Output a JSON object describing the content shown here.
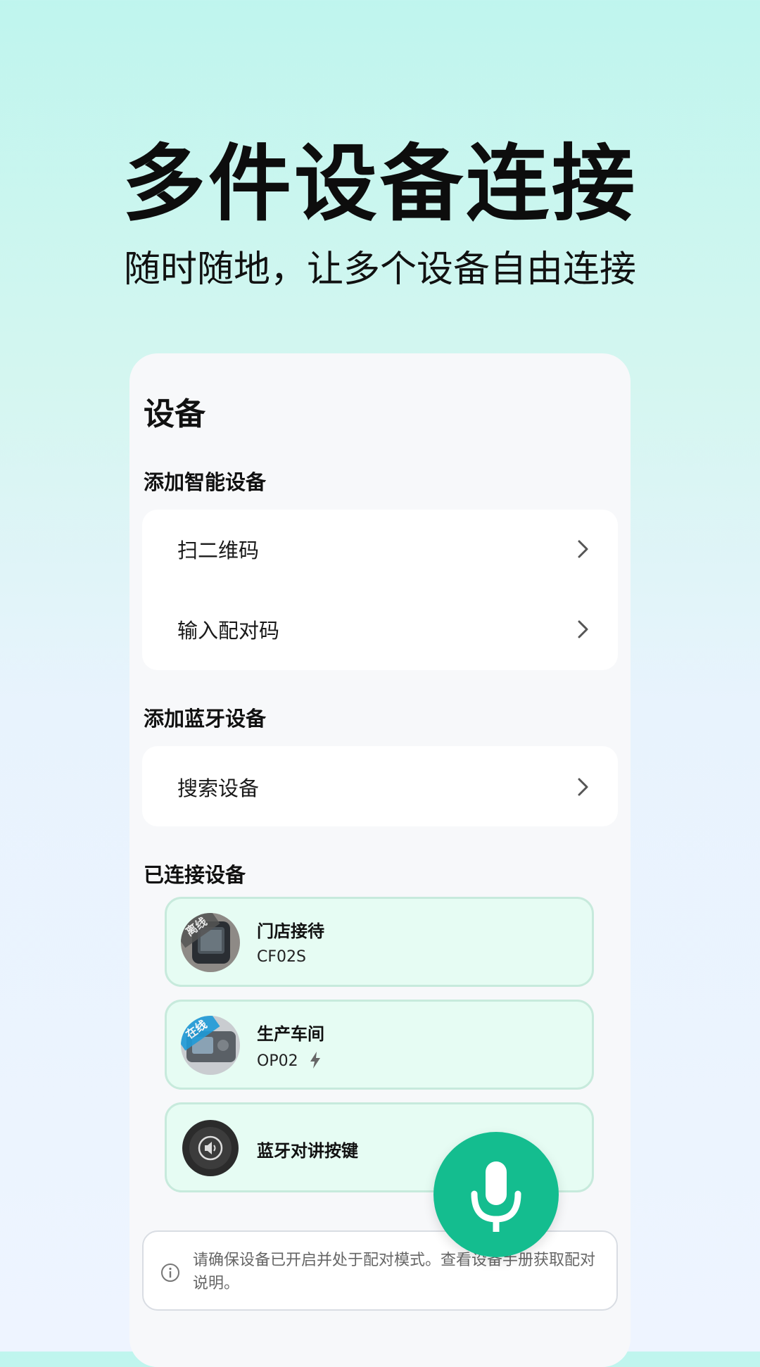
{
  "hero": {
    "title": "多件设备连接",
    "subtitle": "随时随地，让多个设备自由连接"
  },
  "panel": {
    "title": "设备",
    "smart_section": {
      "label": "添加智能设备",
      "items": [
        {
          "label": "扫二维码",
          "icon": "chevron-right-icon"
        },
        {
          "label": "输入配对码",
          "icon": "chevron-right-icon"
        }
      ]
    },
    "bluetooth_section": {
      "label": "添加蓝牙设备",
      "items": [
        {
          "label": "搜索设备",
          "icon": "chevron-right-icon"
        }
      ]
    },
    "connected_section": {
      "label": "已连接设备",
      "devices": [
        {
          "name": "门店接待",
          "model": "CF02S",
          "status": "离线",
          "status_color": "#555555",
          "icon": "device-photo"
        },
        {
          "name": "生产车间",
          "model": "OP02",
          "status": "在线",
          "status_color": "#1e9bd7",
          "icon": "device-photo",
          "charging_icon": "bolt-icon"
        },
        {
          "name": "蓝牙对讲按键",
          "model": "",
          "status": "",
          "icon": "speaker-button-icon"
        }
      ]
    },
    "notice": {
      "text": "请确保设备已开启并处于配对模式。查看设备手册获取配对说明。",
      "icon": "info-icon"
    }
  },
  "fab": {
    "icon": "microphone-icon",
    "color": "#14bd8f"
  }
}
